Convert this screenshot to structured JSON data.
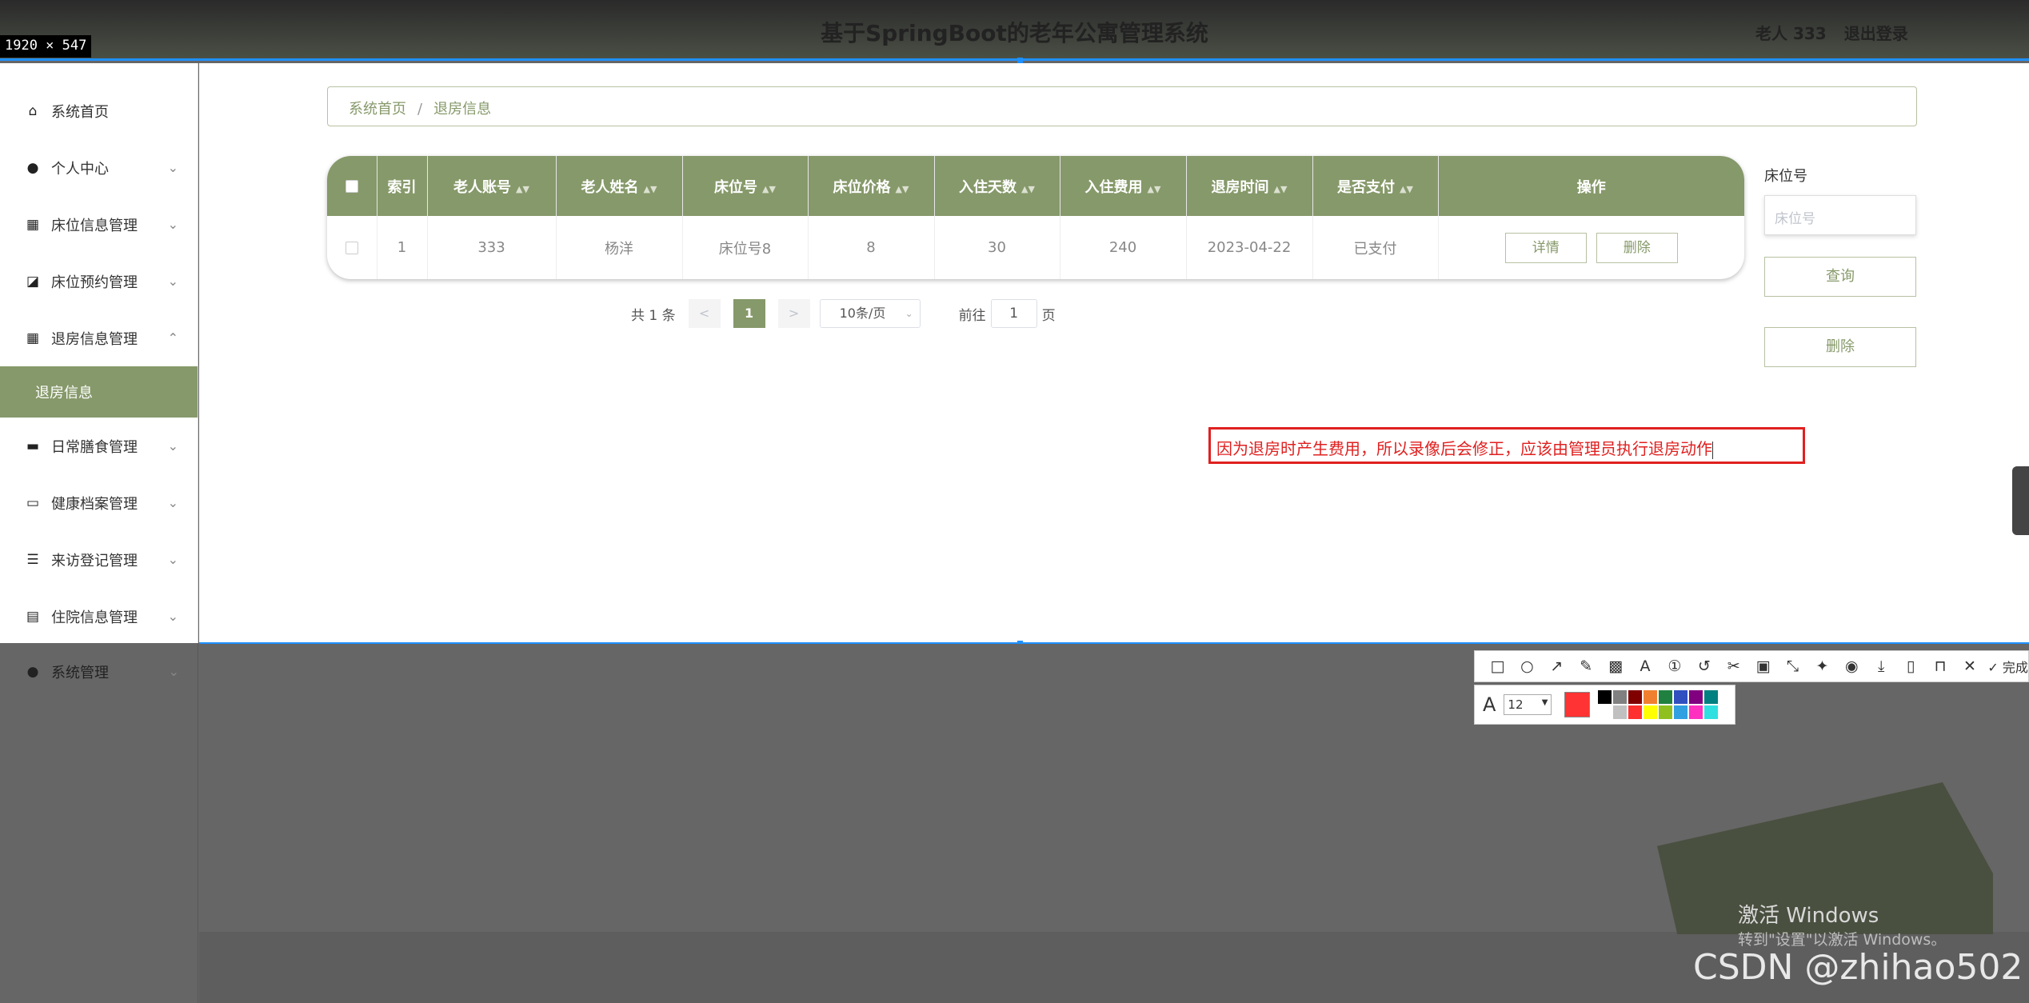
{
  "header": {
    "title": "基于SpringBoot的老年公寓管理系统",
    "user_label": "老人 333",
    "logout_label": "退出登录",
    "dimension_tag": "1920 × 547"
  },
  "sidebar": {
    "items": [
      {
        "label": "系统首页",
        "icon": "home-icon",
        "has_chevron": false
      },
      {
        "label": "个人中心",
        "icon": "user-icon",
        "has_chevron": true
      },
      {
        "label": "床位信息管理",
        "icon": "grid-icon",
        "has_chevron": true
      },
      {
        "label": "床位预约管理",
        "icon": "chart-icon",
        "has_chevron": true
      },
      {
        "label": "退房信息管理",
        "icon": "grid-icon",
        "has_chevron": true,
        "expanded": true
      },
      {
        "label": "退房信息",
        "icon": "",
        "active": true
      },
      {
        "label": "日常膳食管理",
        "icon": "briefcase-icon",
        "has_chevron": true
      },
      {
        "label": "健康档案管理",
        "icon": "archive-icon",
        "has_chevron": true
      },
      {
        "label": "来访登记管理",
        "icon": "sliders-icon",
        "has_chevron": true
      },
      {
        "label": "住院信息管理",
        "icon": "clipboard-icon",
        "has_chevron": true
      },
      {
        "label": "系统管理",
        "icon": "admin-icon",
        "has_chevron": true
      }
    ]
  },
  "breadcrumb": {
    "home": "系统首页",
    "separator": "/",
    "current": "退房信息"
  },
  "table": {
    "headers": [
      "索引",
      "老人账号",
      "老人姓名",
      "床位号",
      "床位价格",
      "入住天数",
      "入住费用",
      "退房时间",
      "是否支付",
      "操作"
    ],
    "rows": [
      {
        "index": "1",
        "account": "333",
        "name": "杨洋",
        "bed_no": "床位号8",
        "bed_price": "8",
        "days": "30",
        "fee": "240",
        "checkout_time": "2023-04-22",
        "paid": "已支付"
      }
    ],
    "action_detail": "详情",
    "action_delete": "删除"
  },
  "pagination": {
    "total": "共 1 条",
    "prev": "<",
    "current": "1",
    "next": ">",
    "page_size": "10条/页",
    "goto_prefix": "前往",
    "goto_value": "1",
    "goto_suffix": "页"
  },
  "search": {
    "label": "床位号",
    "placeholder": "床位号",
    "query_button": "查询",
    "delete_button": "删除"
  },
  "annotation": {
    "text": "因为退房时产生费用，所以录像后会修正，应该由管理员执行退房动作",
    "color": "#e02020"
  },
  "capture_toolbar": {
    "done_label": "完成",
    "font_size": "12",
    "current_color": "#ff3333",
    "palette": [
      "#000000",
      "#808080",
      "#800000",
      "#f08030",
      "#208040",
      "#3050c0",
      "#800080",
      "#008080",
      "#ffffff",
      "#c0c0c0",
      "#ff3030",
      "#ffff00",
      "#90c020",
      "#30a0e0",
      "#ff30c0",
      "#30e0e0"
    ]
  },
  "watermark": {
    "activate_title": "激活 Windows",
    "activate_sub": "转到\"设置\"以激活 Windows。",
    "csdn": "CSDN @zhihao502"
  },
  "colors": {
    "accent": "#86996a",
    "selection": "#1e90ff"
  }
}
